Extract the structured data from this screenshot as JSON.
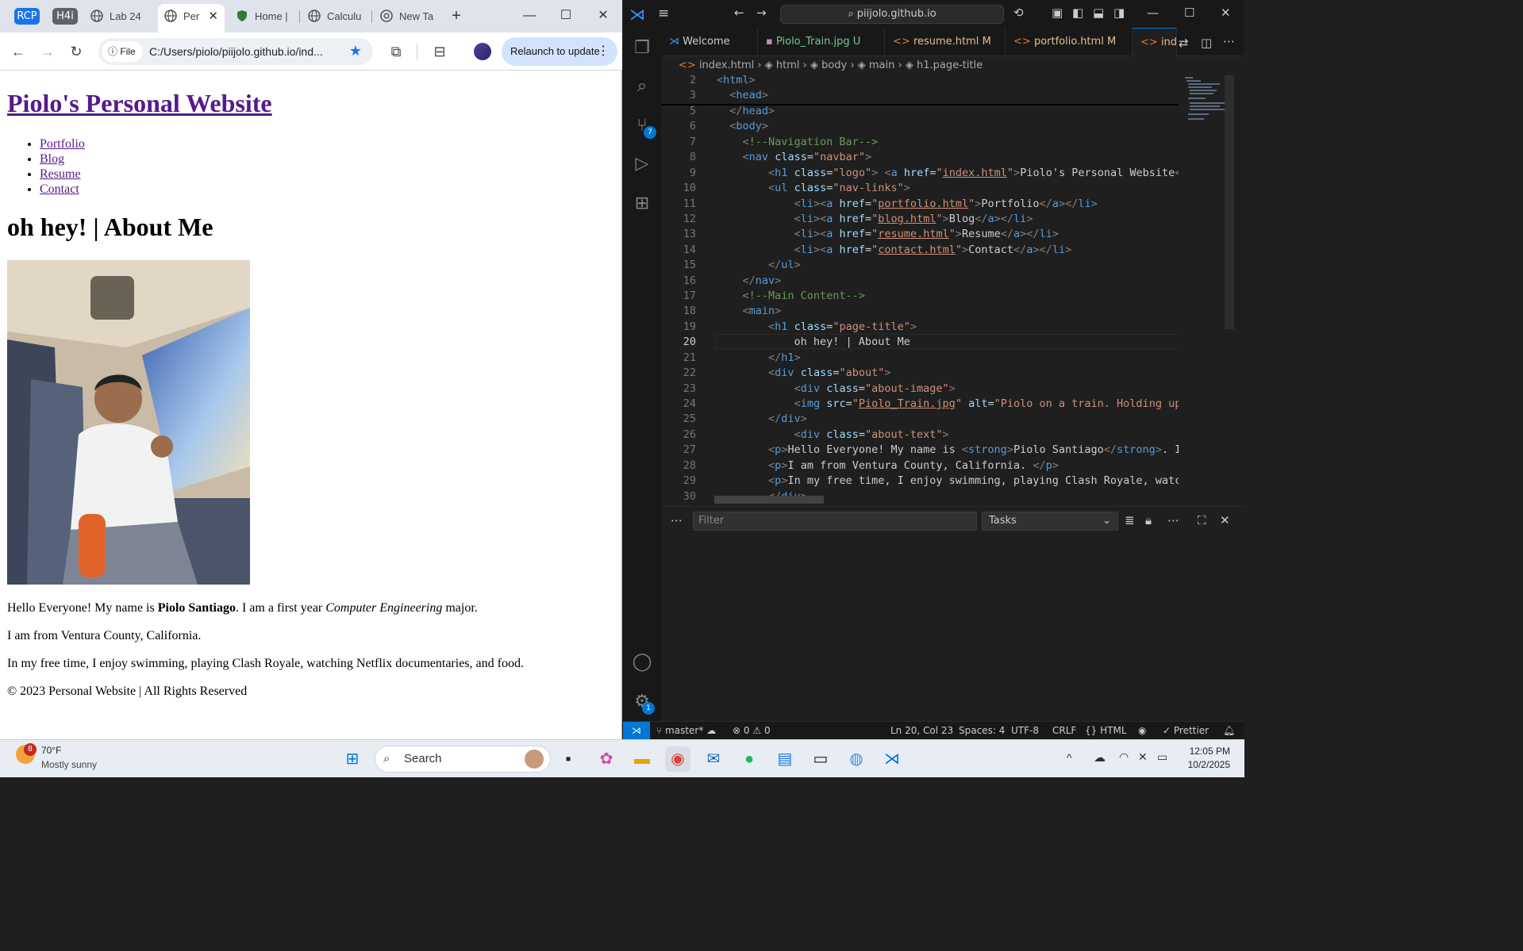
{
  "browser": {
    "pills": [
      "RCP",
      "H4i"
    ],
    "tabs": [
      "Lab 24",
      "Per",
      "Home |",
      "Calculu",
      "New Ta"
    ],
    "url": "C:/Users/piolo/piijolo.github.io/ind...",
    "scheme_label": "File",
    "relaunch_label": "Relaunch to update"
  },
  "page": {
    "site_title": "Piolo's Personal Website",
    "nav": [
      "Portfolio",
      "Blog",
      "Resume",
      "Contact"
    ],
    "heading": "oh hey! | About Me",
    "intro_before": "Hello Everyone! My name is ",
    "intro_name": "Piolo Santiago",
    "intro_mid": ". I am a first year ",
    "intro_major": "Computer Engineering",
    "intro_after": " major.",
    "hometown": "I am from Ventura County, California.",
    "hobbies": "In my free time, I enjoy swimming, playing Clash Royale, watching Netflix documentaries, and food.",
    "footer": "© 2023 Personal Website | All Rights Reserved"
  },
  "vscode": {
    "search": "piijolo.github.io",
    "tabs": [
      {
        "label": "Welcome",
        "color": "#cccccc",
        "icon": "vscode-icon"
      },
      {
        "label": "Piolo_Train.jpg",
        "suffix": "U",
        "color": "#73c991",
        "icon": "image-icon"
      },
      {
        "label": "resume.html",
        "suffix": "M",
        "color": "#e2c08d",
        "icon": "html-icon"
      },
      {
        "label": "portfolio.html",
        "suffix": "M",
        "color": "#e2c08d",
        "icon": "html-icon"
      },
      {
        "label": "ind",
        "color": "#e2c08d",
        "icon": "html-icon"
      }
    ],
    "breadcrumb": [
      "index.html",
      "html",
      "body",
      "main",
      "h1.page-title"
    ],
    "line_numbers": [
      "2",
      "3",
      "5",
      "6",
      "7",
      "8",
      "9",
      "10",
      "11",
      "12",
      "13",
      "14",
      "15",
      "16",
      "17",
      "18",
      "19",
      "20",
      "21",
      "22",
      "23",
      "24",
      "25",
      "26",
      "27",
      "28",
      "29",
      "30"
    ],
    "current_line": "20",
    "panel_filter_placeholder": "Filter",
    "panel_tasks": "Tasks",
    "badges": {
      "scm": "7",
      "settings": "1"
    },
    "status": {
      "branch": "master*",
      "errors": "0",
      "warnings": "0",
      "position": "Ln 20, Col 23",
      "spaces": "Spaces: 4",
      "encoding": "UTF-8",
      "eol": "CRLF",
      "language": "HTML",
      "formatter": "Prettier"
    }
  },
  "taskbar": {
    "weather_temp": "70°F",
    "weather_desc": "Mostly sunny",
    "weather_badge": "8",
    "search": "Search",
    "time": "12:05 PM",
    "date": "10/2/2025"
  },
  "colors": {
    "accent": "#0078d4",
    "link_visited": "#551a8b",
    "relaunch_bg": "#d3e3fd"
  }
}
